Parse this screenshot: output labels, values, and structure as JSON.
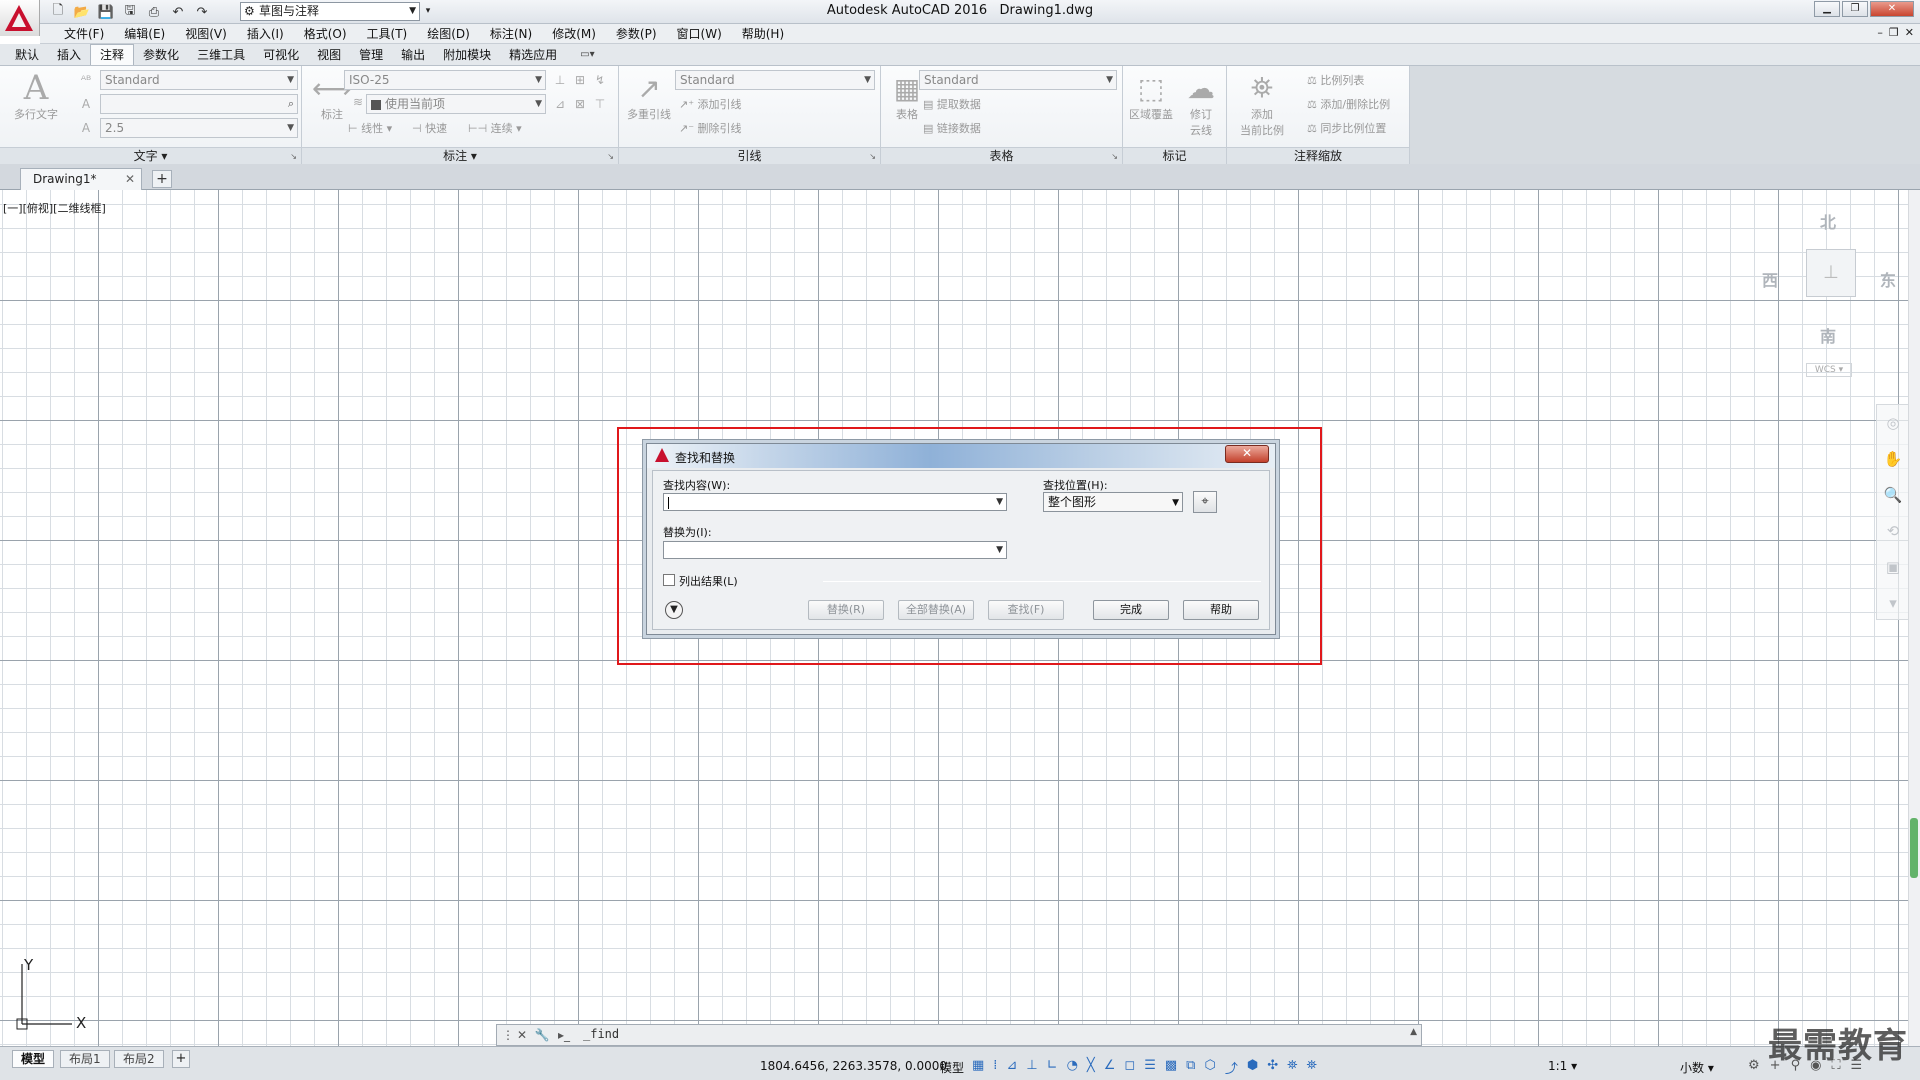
{
  "app": {
    "title": "Autodesk AutoCAD 2016",
    "file": "Drawing1.dwg",
    "workspace": "草图与注释"
  },
  "menu": [
    "文件(F)",
    "编辑(E)",
    "视图(V)",
    "插入(I)",
    "格式(O)",
    "工具(T)",
    "绘图(D)",
    "标注(N)",
    "修改(M)",
    "参数(P)",
    "窗口(W)",
    "帮助(H)"
  ],
  "ribbon_tabs": [
    "默认",
    "插入",
    "注释",
    "参数化",
    "三维工具",
    "可视化",
    "视图",
    "管理",
    "输出",
    "附加模块",
    "精选应用"
  ],
  "ribbon_active_tab": "注释",
  "ribbon": {
    "text_panel": {
      "label": "文字",
      "big": "多行文字",
      "style": "Standard",
      "height": "2.5"
    },
    "dim_panel": {
      "label": "标注",
      "big": "标注",
      "style": "ISO-25",
      "layer": "使用当前项",
      "linear": "线性",
      "quick": "快速",
      "continue": "连续"
    },
    "leader_panel": {
      "label": "引线",
      "big": "多重引线",
      "style": "Standard",
      "add": "添加引线",
      "remove": "删除引线"
    },
    "table_panel": {
      "label": "表格",
      "big": "表格",
      "style": "Standard",
      "extract": "提取数据",
      "link": "链接数据"
    },
    "markup_panel": {
      "label": "标记",
      "wipeout": "区域覆盖",
      "revcloud_1": "修订",
      "revcloud_2": "云线"
    },
    "scale_panel": {
      "label": "注释缩放",
      "add_current_1": "添加",
      "add_current_2": "当前比例",
      "scale_list": "比例列表",
      "add_delete": "添加/删除比例",
      "sync": "同步比例位置"
    }
  },
  "doc_tab": "Drawing1*",
  "viewport_label": "[一][俯视][二维线框]",
  "viewcube": {
    "north": "北",
    "south": "南",
    "east": "东",
    "west": "西",
    "wcs": "WCS"
  },
  "ucs": {
    "x": "X",
    "y": "Y"
  },
  "dialog": {
    "title": "查找和替换",
    "find_label": "查找内容(W):",
    "find_value": "",
    "location_label": "查找位置(H):",
    "location_value": "整个图形",
    "replace_label": "替换为(I):",
    "replace_value": "",
    "list_results": "列出结果(L)",
    "list_results_checked": false,
    "buttons": {
      "replace": "替换(R)",
      "replace_all": "全部替换(A)",
      "find": "查找(F)",
      "done": "完成",
      "help": "帮助"
    }
  },
  "command_line": "_find",
  "layout_tabs": [
    "模型",
    "布局1",
    "布局2"
  ],
  "status": {
    "coords": "1804.6456, 2263.3578, 0.0000",
    "space": "模型",
    "scale": "1:1",
    "units": "小数"
  },
  "watermark": "最需教育",
  "colors": {
    "highlight": "#e0181b",
    "autocad_red": "#c8102e"
  }
}
